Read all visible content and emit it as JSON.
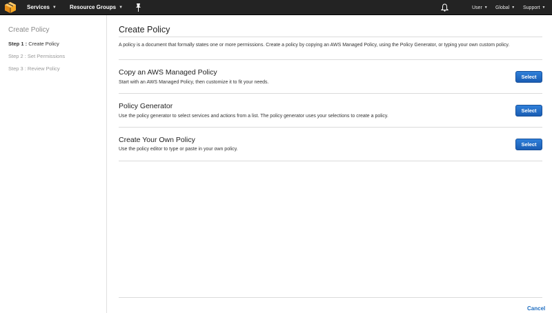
{
  "topbar": {
    "services_label": "Services",
    "resource_groups_label": "Resource Groups",
    "user_label": "User",
    "region_label": "Global",
    "support_label": "Support"
  },
  "sidebar": {
    "title": "Create Policy",
    "steps": [
      {
        "prefix": "Step 1 :",
        "label": "Create Policy"
      },
      {
        "label": "Step 2 : Set Permissions"
      },
      {
        "label": "Step 3 : Review Policy"
      }
    ]
  },
  "main": {
    "title": "Create Policy",
    "intro": "A policy is a document that formally states one or more permissions. Create a policy by copying an AWS Managed Policy, using the Policy Generator, or typing your own custom policy.",
    "options": [
      {
        "title": "Copy an AWS Managed Policy",
        "description": "Start with an AWS Managed Policy, then customize it to fit your needs.",
        "button": "Select"
      },
      {
        "title": "Policy Generator",
        "description": "Use the policy generator to select services and actions from a list. The policy generator uses your selections to create a policy.",
        "button": "Select"
      },
      {
        "title": "Create Your Own Policy",
        "description": "Use the policy editor to type or paste in your own policy.",
        "button": "Select"
      }
    ],
    "cancel_label": "Cancel"
  },
  "colors": {
    "topbar_bg": "#232323",
    "primary_button": "#1a5db3",
    "link": "#1e6dc1",
    "logo": "#f7a825"
  },
  "icons": [
    "aws-cube-icon",
    "pin-icon",
    "bell-icon",
    "caret-down-icon"
  ]
}
